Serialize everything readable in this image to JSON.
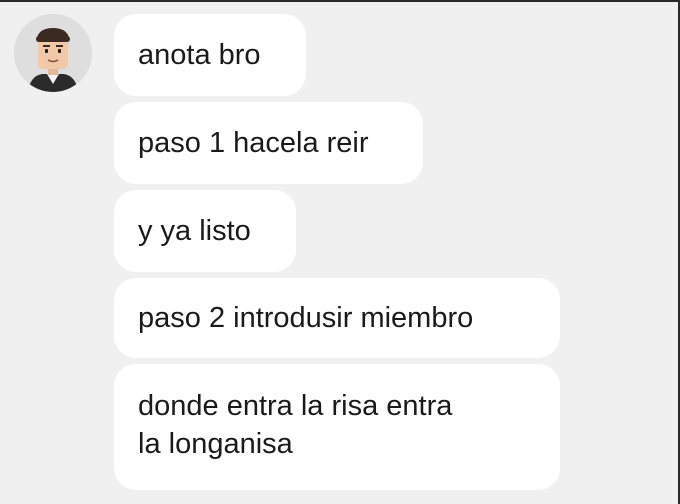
{
  "chat": {
    "avatar_icon": "roblox-avatar-icon",
    "messages": [
      {
        "text": "anota bro"
      },
      {
        "text": "paso 1 hacela reir"
      },
      {
        "text": "y ya listo"
      },
      {
        "text": "paso 2 introdusir miembro"
      },
      {
        "lines": [
          "donde entra la risa entra",
          "la longanisa"
        ]
      }
    ],
    "colors": {
      "background": "#f0f0f0",
      "bubble": "#ffffff",
      "text": "#1a1a1a"
    }
  }
}
